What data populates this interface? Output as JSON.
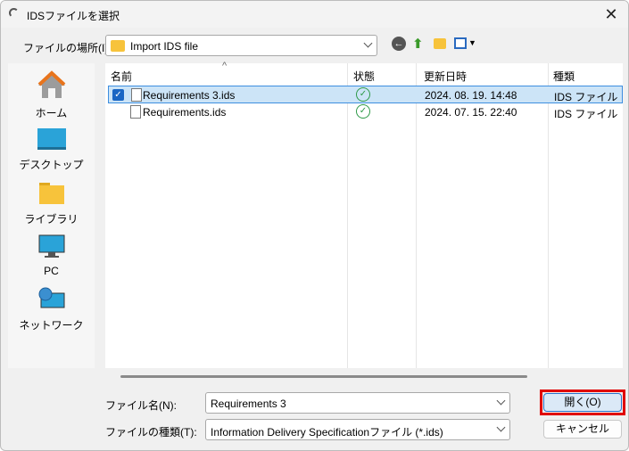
{
  "title": "IDSファイルを選択",
  "location": {
    "label": "ファイルの場所(I):",
    "value": "Import IDS file"
  },
  "sidebar": {
    "items": [
      {
        "label": "ホーム"
      },
      {
        "label": "デスクトップ"
      },
      {
        "label": "ライブラリ"
      },
      {
        "label": "PC"
      },
      {
        "label": "ネットワーク"
      }
    ]
  },
  "columns": [
    "名前",
    "状態",
    "更新日時",
    "種類"
  ],
  "files": [
    {
      "name": "Requirements 3.ids",
      "date": "2024. 08. 19. 14:48",
      "type": "IDS ファイル",
      "selected": true
    },
    {
      "name": "Requirements.ids",
      "date": "2024. 07. 15. 22:40",
      "type": "IDS ファイル",
      "selected": false
    }
  ],
  "filename": {
    "label": "ファイル名(N):",
    "value": "Requirements 3"
  },
  "filetype": {
    "label": "ファイルの種類(T):",
    "value": "Information Delivery Specificationファイル (*.ids)"
  },
  "buttons": {
    "open": "開く(O)",
    "cancel": "キャンセル"
  },
  "colors": {
    "accent": "#1a66c4",
    "highlight": "#e00000"
  }
}
